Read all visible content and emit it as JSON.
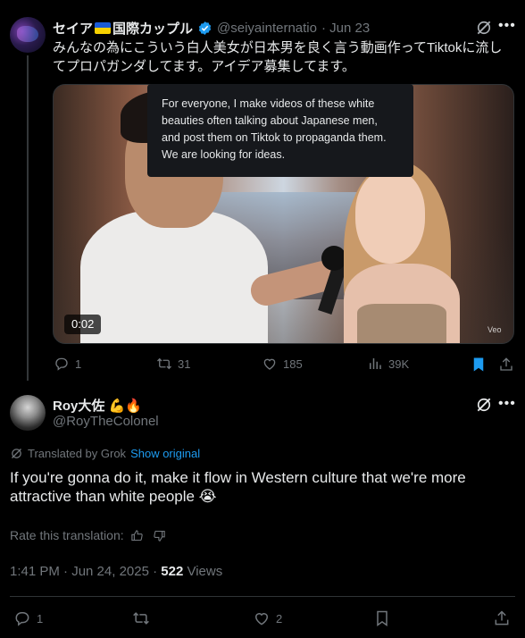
{
  "original_post": {
    "author_name": "セイア",
    "author_name_suffix": "国際カップル",
    "handle": "@seiyainternatio",
    "date": "· Jun 23",
    "text": "みんなの為にこういう白人美女が日本男を良く言う動画作ってTiktokに流してプロパガンダしてます。アイデア募集してます。",
    "media": {
      "tooltip_text": "For everyone, I make videos of these white beauties often talking about Japanese men, and post them on Tiktok to propaganda them. We are looking for ideas.",
      "duration": "0:02",
      "watermark": "Veo"
    },
    "actions": {
      "replies": "1",
      "reposts": "31",
      "likes": "185",
      "views": "39K"
    }
  },
  "reply": {
    "author_name": "Roy大佐",
    "handle": "@RoyTheColonel",
    "translated_label": "Translated by Grok",
    "show_original": "Show original",
    "text": "If you're gonna do it, make it flow in Western culture that we're more attractive than white people 😭",
    "rate_label": "Rate this translation:",
    "timestamp": "1:41 PM · Jun 24, 2025 · ",
    "views_count": "522",
    "views_label": "Views",
    "actions": {
      "replies": "1",
      "likes": "2"
    }
  },
  "colors": {
    "background": "#000000",
    "text": "#e7e9ea",
    "muted": "#71767b",
    "accent": "#1d9bf0",
    "divider": "#2f3336"
  },
  "icons": [
    "grok-icon",
    "more-icon",
    "verified-icon",
    "reply-icon",
    "repost-icon",
    "like-icon",
    "views-icon",
    "bookmark-icon",
    "share-icon",
    "thumbs-up-icon",
    "thumbs-down-icon"
  ]
}
